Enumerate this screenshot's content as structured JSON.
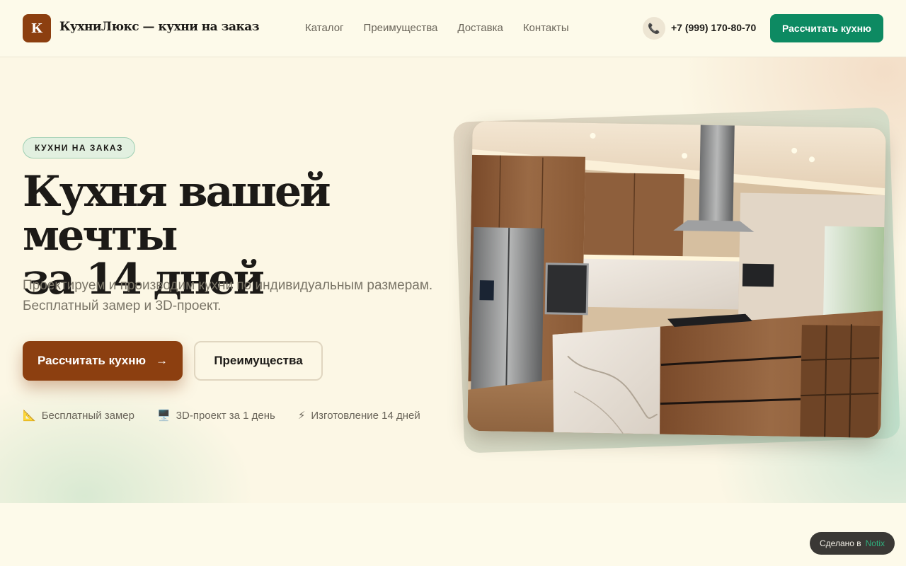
{
  "header": {
    "logo_letter": "К",
    "brand": "КухниЛюкс — кухни на заказ",
    "nav": [
      "Каталог",
      "Преимущества",
      "Доставка",
      "Контакты"
    ],
    "phone": "+7 (999) 170-80-70",
    "cta": "Рассчитать кухню"
  },
  "hero": {
    "badge": "КУХНИ НА ЗАКАЗ",
    "title_line1": "Кухня вашей мечты",
    "title_line2": "за 14 дней",
    "subtitle_line1": "Проектируем и производим кухни по индивидуальным размерам.",
    "subtitle_line2": "Бесплатный замер и 3D-проект.",
    "primary_button": "Рассчитать кухню",
    "primary_arrow": "→",
    "secondary_button": "Преимущества",
    "features": [
      {
        "icon": "📐",
        "icon_name": "triangle-ruler-icon",
        "label": "Бесплатный замер"
      },
      {
        "icon": "🖥️",
        "icon_name": "monitor-icon",
        "label": "3D-проект за 1 день"
      },
      {
        "icon": "⚡",
        "icon_name": "lightning-icon",
        "label": "Изготовление 14 дней"
      }
    ]
  },
  "footer_badge": {
    "prefix": "Сделано в",
    "brand": "Notix"
  },
  "colors": {
    "background": "#fdfaea",
    "brand_brown": "#8c3f10",
    "accent_green": "#0d8a62"
  }
}
